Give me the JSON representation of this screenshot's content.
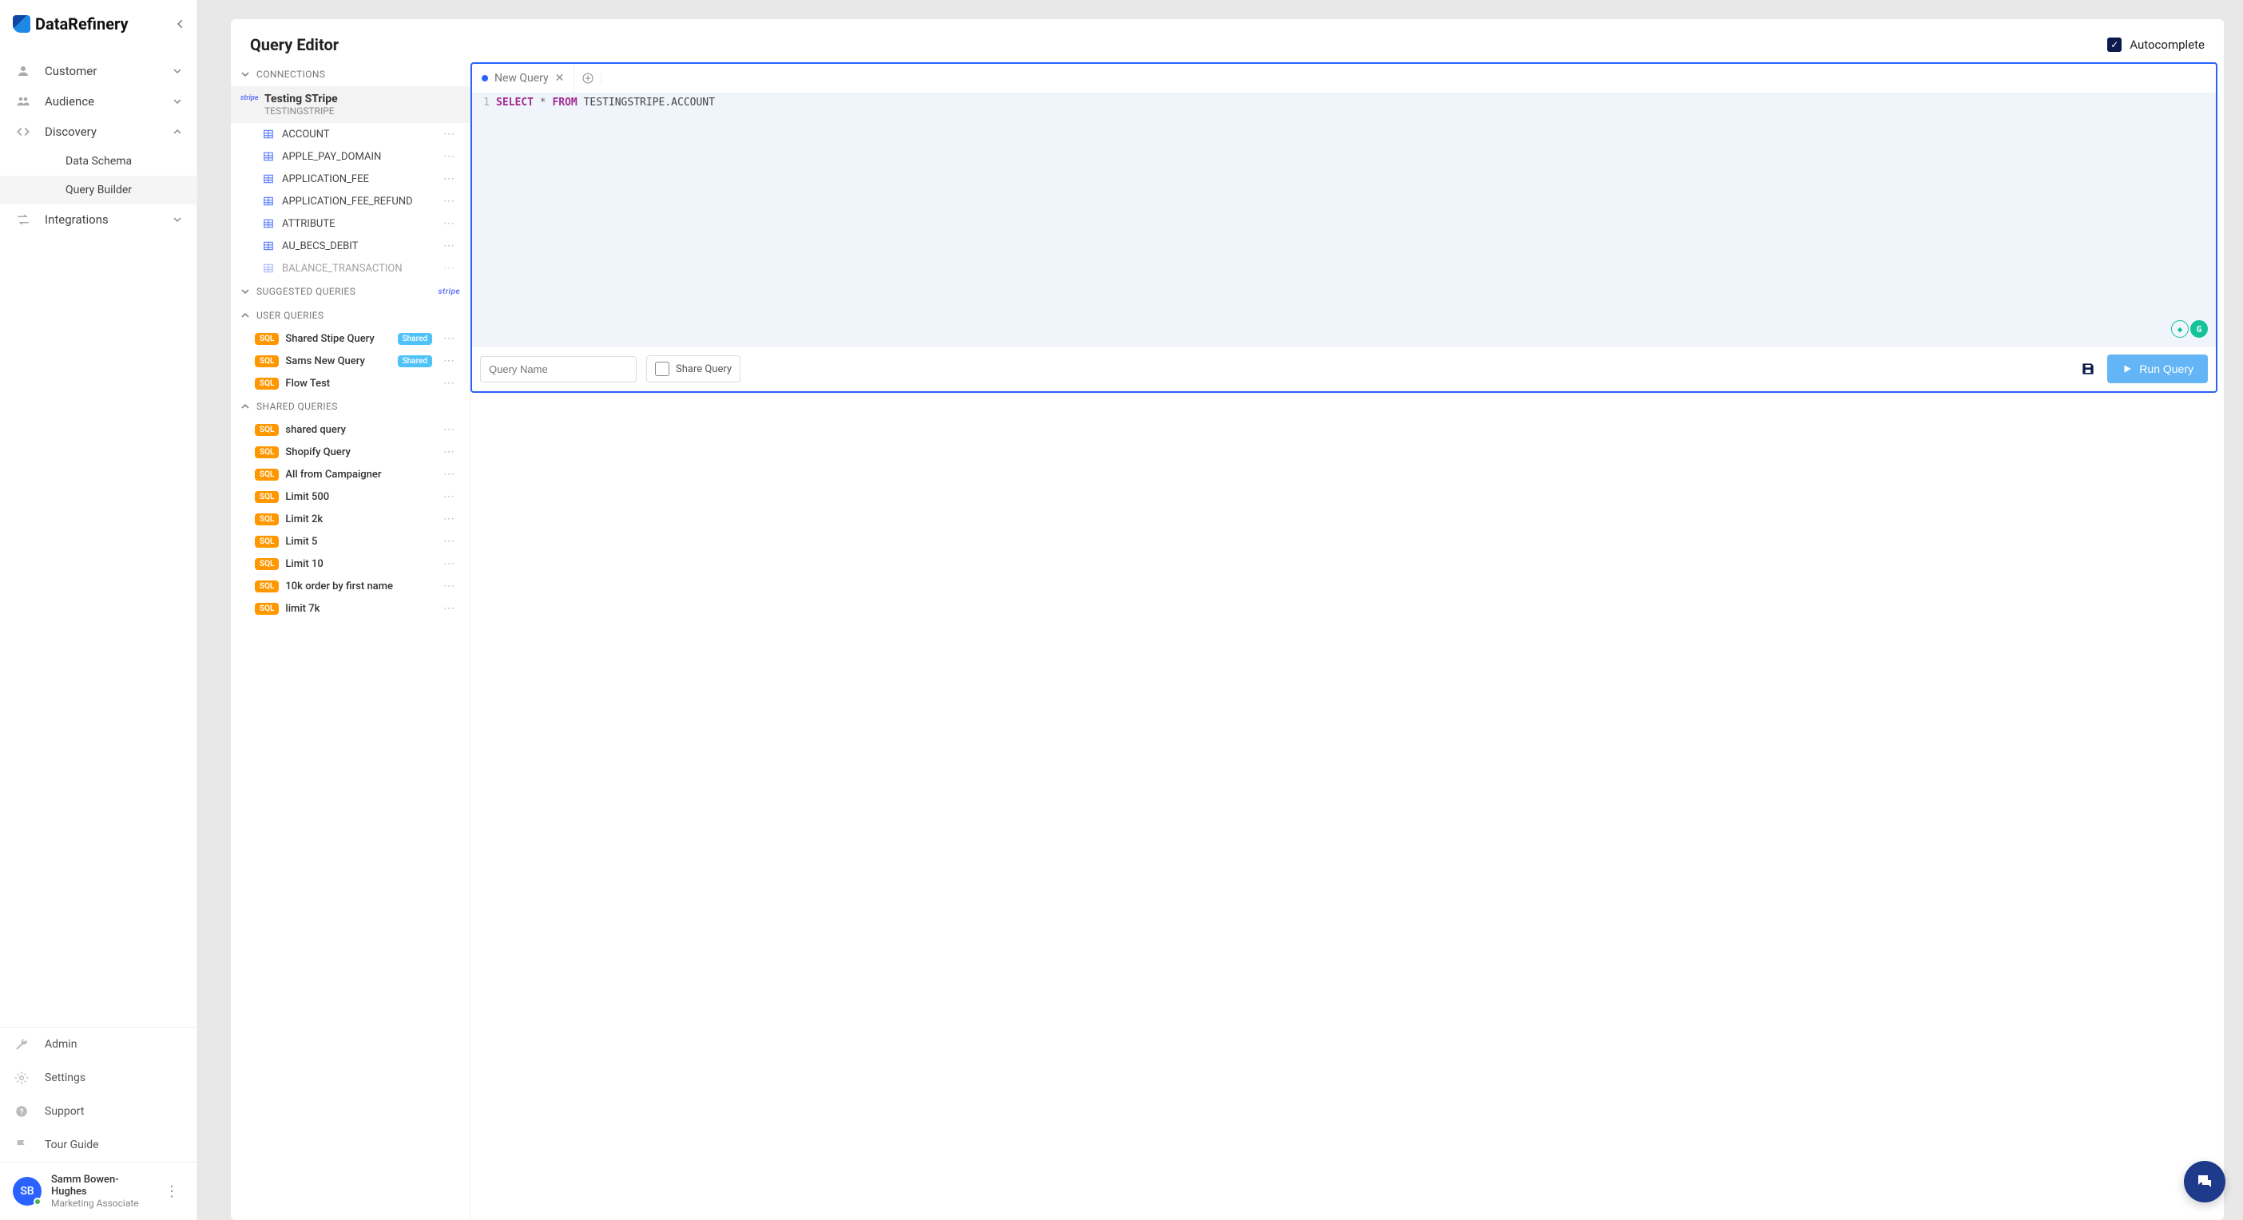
{
  "brand": {
    "name": "DataRefinery"
  },
  "nav": {
    "customer": "Customer",
    "audience": "Audience",
    "discovery": "Discovery",
    "data_schema": "Data Schema",
    "query_builder": "Query Builder",
    "integrations": "Integrations"
  },
  "bottom": {
    "admin": "Admin",
    "settings": "Settings",
    "support": "Support",
    "tour_guide": "Tour Guide"
  },
  "user": {
    "initials": "SB",
    "name": "Samm Bowen-Hughes",
    "role": "Marketing Associate"
  },
  "page": {
    "title": "Query Editor",
    "autocomplete_label": "Autocomplete"
  },
  "connections": {
    "header": "CONNECTIONS",
    "active": {
      "name": "Testing STripe",
      "schema": "TESTINGSTRIPE",
      "provider": "stripe"
    },
    "tables": [
      "ACCOUNT",
      "APPLE_PAY_DOMAIN",
      "APPLICATION_FEE",
      "APPLICATION_FEE_REFUND",
      "ATTRIBUTE",
      "AU_BECS_DEBIT",
      "BALANCE_TRANSACTION"
    ]
  },
  "suggested": {
    "header": "SUGGESTED QUERIES",
    "provider": "stripe"
  },
  "user_queries": {
    "header": "USER QUERIES",
    "items": [
      {
        "name": "Shared Stipe Query",
        "shared": true
      },
      {
        "name": "Sams New Query",
        "shared": true
      },
      {
        "name": "Flow Test",
        "shared": false
      }
    ]
  },
  "shared_queries": {
    "header": "SHARED QUERIES",
    "items": [
      "shared query",
      "Shopify Query",
      "All from Campaigner",
      "Limit 500",
      "Limit 2k",
      "Limit 5",
      "Limit 10",
      "10k order by first name",
      "limit 7k"
    ]
  },
  "editor": {
    "tab_label": "New Query",
    "line_no": "1",
    "kw_select": "SELECT",
    "star": " * ",
    "kw_from": "FROM",
    "ident": " TESTINGSTRIPE.ACCOUNT",
    "qname_placeholder": "Query Name",
    "share_label": "Share Query",
    "run_label": "Run Query"
  },
  "badges": {
    "sql": "SQL",
    "shared": "Shared"
  }
}
